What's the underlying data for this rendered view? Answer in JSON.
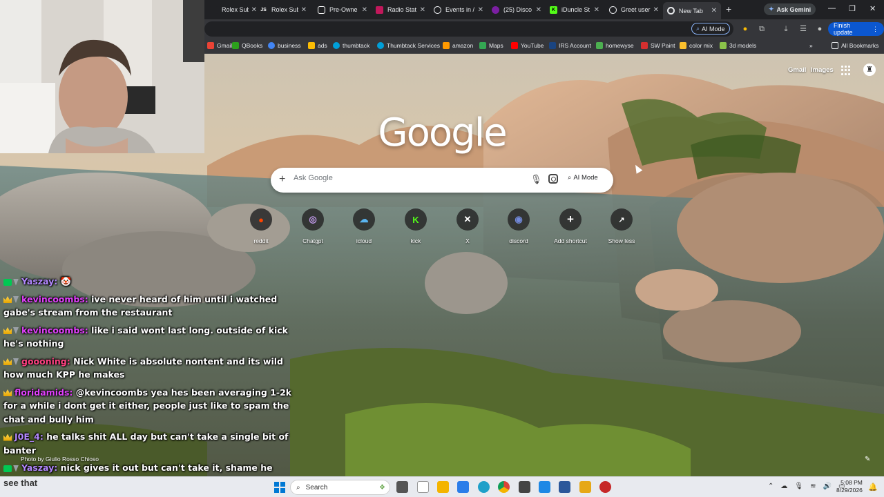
{
  "browser": {
    "tabs": [
      {
        "label": "Rolex Subr",
        "color": "#202124",
        "glyph": ""
      },
      {
        "label": "Rolex Subr",
        "color": "#202124",
        "glyph": "JS"
      },
      {
        "label": "Pre-Owne",
        "color": "#202124",
        "glyph": ""
      },
      {
        "label": "Radio Stat",
        "color": "#c2185b",
        "glyph": ""
      },
      {
        "label": "Events in /",
        "color": "#5f6368",
        "glyph": ""
      },
      {
        "label": "(25) Disco",
        "color": "#7b1fa2",
        "glyph": ""
      },
      {
        "label": "iDuncle St",
        "color": "#53fc18",
        "glyph": "K"
      },
      {
        "label": "Greet user",
        "color": "#5f6368",
        "glyph": ""
      },
      {
        "label": "New Tab",
        "color": "#5f6368",
        "glyph": ""
      }
    ],
    "new_tab_symbol": "+",
    "ask_gemini": "Ask Gemini",
    "omnibox_ai_mode": "AI Mode",
    "finish_update": "Finish update",
    "bookmarks": [
      {
        "label": "Gmail",
        "color": "#ea4335"
      },
      {
        "label": "QBooks",
        "color": "#2ca01c"
      },
      {
        "label": "business",
        "color": "#4285f4"
      },
      {
        "label": "ads",
        "color": "#fbbc04"
      },
      {
        "label": "thumbtack",
        "color": "#009fd9"
      },
      {
        "label": "Thumbtack Services",
        "color": "#009fd9"
      },
      {
        "label": "amazon",
        "color": "#ff9900"
      },
      {
        "label": "Maps",
        "color": "#34a853"
      },
      {
        "label": "YouTube",
        "color": "#ff0000"
      },
      {
        "label": "IRS Account",
        "color": "#1a4480"
      },
      {
        "label": "homewyse",
        "color": "#4caf50"
      },
      {
        "label": "SW Paint",
        "color": "#d32f2f"
      },
      {
        "label": "color mix",
        "color": "#fbc02d"
      },
      {
        "label": "3d models",
        "color": "#8bc34a"
      }
    ],
    "all_bookmarks": "All Bookmarks"
  },
  "ntp": {
    "gmail": "Gmail",
    "images": "Images",
    "logo": "Google",
    "search_placeholder": "Ask Google",
    "ai_mode": "AI Mode",
    "shortcuts": [
      {
        "label": "reddit",
        "icon": "reddit-icon",
        "glyph": "●",
        "color": "#ff4500"
      },
      {
        "label": "Chatgpt",
        "icon": "chatgpt-icon",
        "glyph": "◎",
        "color": "#9c6bd6"
      },
      {
        "label": "icloud",
        "icon": "icloud-icon",
        "glyph": "☁",
        "color": "#5ab4f0"
      },
      {
        "label": "kick",
        "icon": "kick-icon",
        "glyph": "K",
        "color": "#53fc18"
      },
      {
        "label": "X",
        "icon": "x-icon",
        "glyph": "✕",
        "color": "#ffffff"
      },
      {
        "label": "discord",
        "icon": "discord-icon",
        "glyph": "◉",
        "color": "#7289da"
      },
      {
        "label": "Add shortcut",
        "icon": "plus-icon",
        "glyph": "+",
        "color": "#ffffff"
      },
      {
        "label": "Show less",
        "icon": "collapse-icon",
        "glyph": "↗",
        "color": "#ffffff"
      }
    ],
    "photo_credit": "Photo by Giulio Rosso Chioso"
  },
  "chat": [
    {
      "badges": [
        "og",
        "v"
      ],
      "user": "Yaszay:",
      "user_color": "#b388ff",
      "text": " 🤡"
    },
    {
      "badges": [
        "crown",
        "v"
      ],
      "user": "kevincoombs:",
      "user_color": "#e040fb",
      "text": " ive never heard of him until i watched gabe's stream from the restaurant"
    },
    {
      "badges": [
        "crown",
        "v"
      ],
      "user": "kevincoombs:",
      "user_color": "#e040fb",
      "text": " like i said wont last long. outside of kick he's nothing"
    },
    {
      "badges": [
        "crown",
        "v"
      ],
      "user": "goooning:",
      "user_color": "#ff4081",
      "text": " Nick White is absolute nontent and its wild how much KPP he makes"
    },
    {
      "badges": [
        "crown"
      ],
      "user": "floridamids:",
      "user_color": "#e040fb",
      "text": " @kevincoombs yea hes been averaging 1-2k for a while i dont get it either, people just like to spam the chat and bully him"
    },
    {
      "badges": [
        "crown"
      ],
      "user": "J0E_4:",
      "user_color": "#b388ff",
      "text": " he talks shit ALL day but can't take a single bit of banter"
    },
    {
      "badges": [
        "og",
        "v"
      ],
      "user": "Yaszay:",
      "user_color": "#b388ff",
      "text": " nick gives it out but can't take it, shame he don't"
    }
  ],
  "taskbar": {
    "weather": "see that",
    "search": "Search",
    "time": "5:08 PM",
    "date": "8/29/2026",
    "apps": [
      {
        "name": "widgets",
        "color": "#6aa84f"
      },
      {
        "name": "task-view",
        "color": "#555555"
      },
      {
        "name": "notepad",
        "color": "#f1f1f1"
      },
      {
        "name": "file-explorer",
        "color": "#f4b400"
      },
      {
        "name": "notes",
        "color": "#2b7de9"
      },
      {
        "name": "edge",
        "color": "#1fa0c9"
      },
      {
        "name": "chrome",
        "color": "#db4437"
      },
      {
        "name": "calculator",
        "color": "#444444"
      },
      {
        "name": "snipping",
        "color": "#1e88e5"
      },
      {
        "name": "word",
        "color": "#2b579a"
      },
      {
        "name": "maps",
        "color": "#e6a817"
      },
      {
        "name": "recorder",
        "color": "#c62828"
      }
    ]
  }
}
